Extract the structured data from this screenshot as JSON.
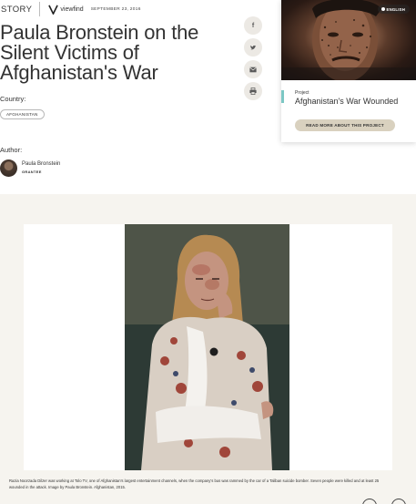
{
  "header": {
    "section_label": "STORY",
    "logo_text": "viewfind",
    "date": "SEPTEMBER 23, 2016"
  },
  "article": {
    "title_lines": [
      "Paula Bronstein on the",
      "Silent Victims of",
      "Afghanistan's War"
    ],
    "country_label": "Country:",
    "country_tag": "AFGHANISTAN",
    "author_label": "Author:",
    "author_name": "Paula Bronstein",
    "author_role": "GRANTEE"
  },
  "social": {
    "icons": [
      "facebook-icon",
      "twitter-icon",
      "email-icon",
      "print-icon"
    ],
    "glyphs": [
      "f",
      "t",
      "✉",
      "⎙"
    ]
  },
  "project_card": {
    "badge": "ENGLISH",
    "kicker": "Project",
    "title": "Afghanistan's War Wounded",
    "button_label": "READ MORE ABOUT THIS PROJECT",
    "accent_color": "#7cc7c4"
  },
  "photo": {
    "caption_lines": [
      "Razia Noorzada Dilzer was working at Tolo TV, one of Afghanistan's largest entertainment channels, when the company's bus was rammed by the car of a Taliban suicide bomber. Seven people were killed and at least 25",
      "wounded in the attack. Image by Paula Bronstein. Afghanistan, 2015."
    ]
  },
  "colors": {
    "text": "#333333",
    "section_background": "#f6f4ef",
    "button_background": "#d9d1bf",
    "social_background": "#ece9e4"
  }
}
